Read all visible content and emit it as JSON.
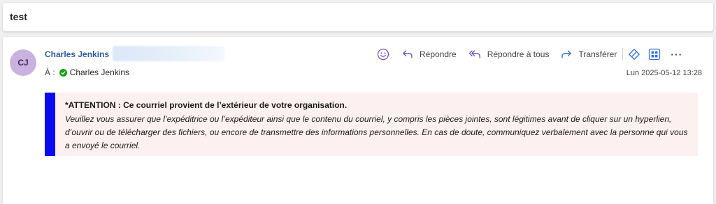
{
  "subject": "test",
  "sender": {
    "initials": "CJ",
    "name": "Charles Jenkins",
    "avatar_color": "#c9b2e0"
  },
  "recipients": {
    "label": "À :",
    "items": [
      "Charles Jenkins"
    ],
    "status_color": "#13a10e"
  },
  "actions": {
    "emoji_icon": "smiley-icon",
    "reply": "Répondre",
    "reply_all": "Répondre à tous",
    "forward": "Transférer",
    "tag_icon": "tag-icon",
    "apps_icon": "apps-icon",
    "more": "···",
    "accent_color": "#6b4fbb"
  },
  "date": "Lun 2025-05-12 13:28",
  "banner": {
    "title": "*ATTENTION : Ce courriel provient de l’extérieur de votre organisation.",
    "body": "Veuillez vous assurer que l’expéditrice ou l’expéditeur ainsi que le contenu du courriel, y compris les pièces jointes, sont légitimes avant de cliquer sur un hyperlien, d’ouvrir ou de télécharger des fichiers, ou encore de transmettre des informations personnelles. En cas de doute, communiquez verbalement avec la personne qui vous a envoyé le courriel.",
    "bar_color": "#0a0af0",
    "background": "#fdf0f0"
  }
}
